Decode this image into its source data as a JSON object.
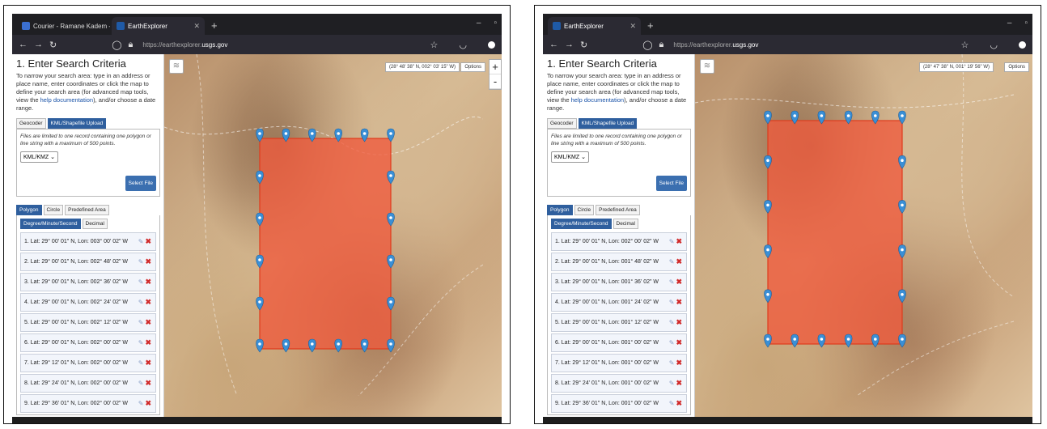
{
  "left": {
    "tabs": [
      {
        "label": "Courier - Ramane Kadem - O..."
      },
      {
        "label": "EarthExplorer"
      }
    ],
    "url_prefix": "https://earthexplorer.",
    "url_domain": "usgs.gov",
    "coord_readout": "(28° 48' 38\" N, 002° 03' 15\" W)",
    "coords": [
      "1. Lat: 29° 00' 01\" N, Lon: 003° 00' 02\" W",
      "2. Lat: 29° 00' 01\" N, Lon: 002° 48' 02\" W",
      "3. Lat: 29° 00' 01\" N, Lon: 002° 36' 02\" W",
      "4. Lat: 29° 00' 01\" N, Lon: 002° 24' 02\" W",
      "5. Lat: 29° 00' 01\" N, Lon: 002° 12' 02\" W",
      "6. Lat: 29° 00' 01\" N, Lon: 002° 00' 02\" W",
      "7. Lat: 29° 12' 01\" N, Lon: 002° 00' 02\" W",
      "8. Lat: 29° 24' 01\" N, Lon: 002° 00' 02\" W",
      "9. Lat: 29° 36' 01\" N, Lon: 002° 00' 02\" W"
    ]
  },
  "right": {
    "tabs": [
      {
        "label": "EarthExplorer"
      }
    ],
    "url_prefix": "https://earthexplorer.",
    "url_domain": "usgs.gov",
    "coord_readout": "(28° 47' 38\" N, 001° 19' 56\" W)",
    "coords": [
      "1. Lat: 29° 00' 01\" N, Lon: 002° 00' 02\" W",
      "2. Lat: 29° 00' 01\" N, Lon: 001° 48' 02\" W",
      "3. Lat: 29° 00' 01\" N, Lon: 001° 36' 02\" W",
      "4. Lat: 29° 00' 01\" N, Lon: 001° 24' 02\" W",
      "5. Lat: 29° 00' 01\" N, Lon: 001° 12' 02\" W",
      "6. Lat: 29° 00' 01\" N, Lon: 001° 00' 02\" W",
      "7. Lat: 29° 12' 01\" N, Lon: 001° 00' 02\" W",
      "8. Lat: 29° 24' 01\" N, Lon: 001° 00' 02\" W",
      "9. Lat: 29° 36' 01\" N, Lon: 001° 00' 02\" W"
    ]
  },
  "panel": {
    "title": "1. Enter Search Criteria",
    "intro_pre": "To narrow your search area: type in an address or place name, enter coordinates or click the map to define your search area (for advanced map tools, view the ",
    "intro_link": "help documentation",
    "intro_post": "), and/or choose a date range.",
    "tab_geocoder": "Geocoder",
    "tab_kml": "KML/Shapefile Upload",
    "upload_note": "Files are limited to one record containing one polygon or line string with a maximum of 500 points.",
    "format_value": "KML/KMZ",
    "select_file": "Select File",
    "tab_polygon": "Polygon",
    "tab_circle": "Circle",
    "tab_predefined": "Predefined Area",
    "fmt_dms": "Degree/Minute/Second",
    "fmt_decimal": "Decimal"
  },
  "map": {
    "options_label": "Options",
    "zoom_in": "+",
    "zoom_out": "-",
    "polygon_color": "#f05a3c"
  }
}
